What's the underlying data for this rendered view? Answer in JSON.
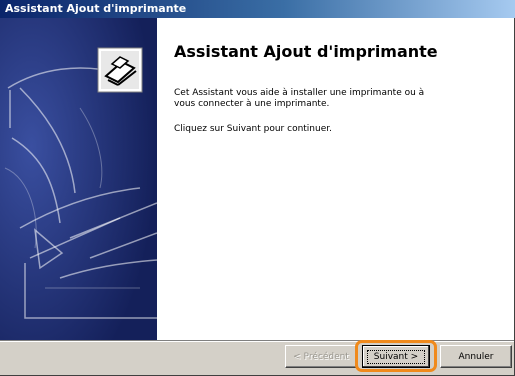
{
  "window": {
    "title": "Assistant Ajout d'imprimante"
  },
  "wizard": {
    "heading": "Assistant Ajout d'imprimante",
    "paragraph1": "Cet Assistant vous aide à installer une imprimante ou à vous connecter à une imprimante.",
    "paragraph2": "Cliquez sur Suivant pour continuer."
  },
  "buttons": {
    "back": "< Précédent",
    "next": "Suivant >",
    "cancel": "Annuler"
  },
  "colors": {
    "title_bar_start": "#0a246a",
    "side_panel": "#1b2d72",
    "highlight": "#f08a1c"
  },
  "icons": {
    "wizard_image": "printer-illustration",
    "corner_badge": "printer-icon"
  }
}
